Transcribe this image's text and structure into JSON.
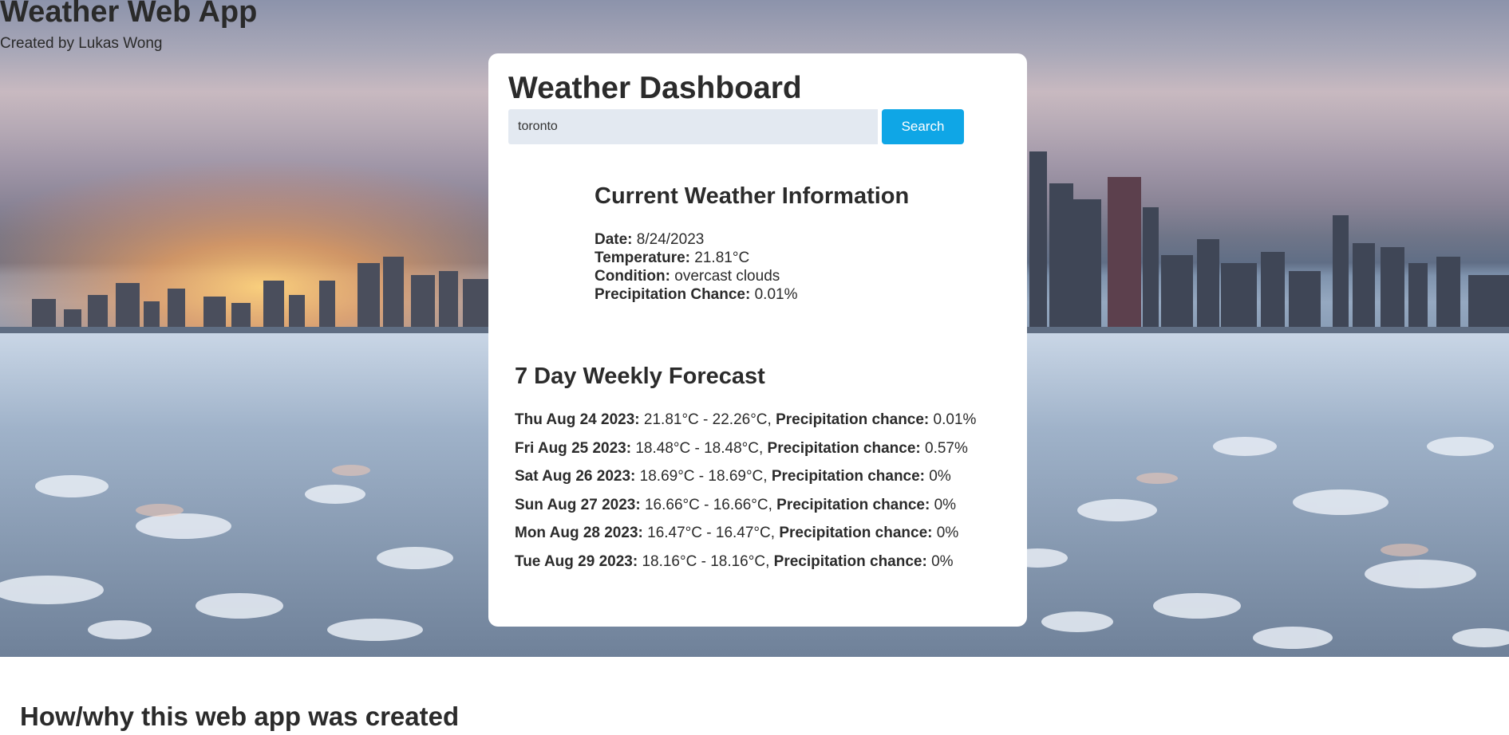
{
  "header": {
    "title": "Weather Web App",
    "subtitle": "Created by Lukas Wong"
  },
  "dashboard": {
    "title": "Weather Dashboard",
    "search": {
      "value": "toronto",
      "button_label": "Search"
    },
    "current": {
      "heading": "Current Weather Information",
      "date_label": "Date:",
      "date_value": "8/24/2023",
      "temp_label": "Temperature:",
      "temp_value": "21.81°C",
      "condition_label": "Condition:",
      "condition_value": "overcast clouds",
      "precip_label": "Precipitation Chance:",
      "precip_value": "0.01%"
    },
    "forecast": {
      "heading": "7 Day Weekly Forecast",
      "precip_label": "Precipitation chance:",
      "days": [
        {
          "date": "Thu Aug 24 2023:",
          "range": "21.81°C - 22.26°C,",
          "precip": "0.01%"
        },
        {
          "date": "Fri Aug 25 2023:",
          "range": "18.48°C - 18.48°C,",
          "precip": "0.57%"
        },
        {
          "date": "Sat Aug 26 2023:",
          "range": "18.69°C - 18.69°C,",
          "precip": "0%"
        },
        {
          "date": "Sun Aug 27 2023:",
          "range": "16.66°C - 16.66°C,",
          "precip": "0%"
        },
        {
          "date": "Mon Aug 28 2023:",
          "range": "16.47°C - 16.47°C,",
          "precip": "0%"
        },
        {
          "date": "Tue Aug 29 2023:",
          "range": "18.16°C - 18.16°C,",
          "precip": "0%"
        }
      ]
    }
  },
  "about": {
    "heading": "How/why this web app was created"
  },
  "colors": {
    "accent": "#0fa6e6",
    "input_bg": "#e3e9f1",
    "text": "#2b2b2b"
  }
}
